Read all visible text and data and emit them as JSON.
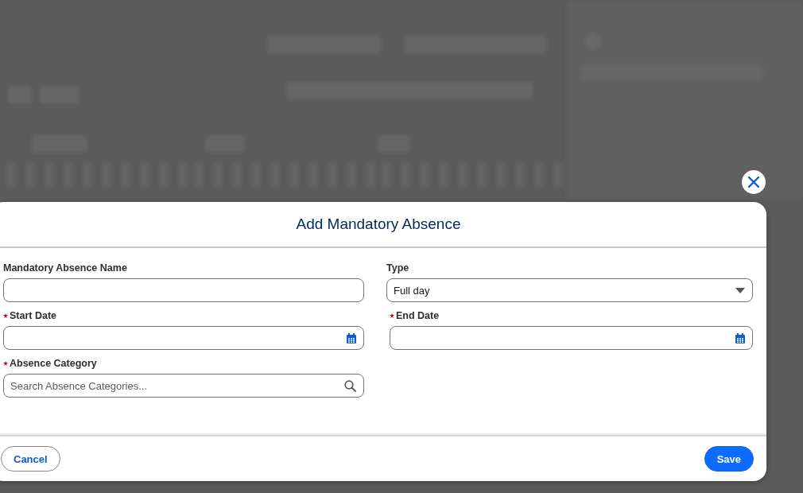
{
  "modal": {
    "title": "Add Mandatory Absence",
    "fields": [
      {
        "kind": "text",
        "label": "Mandatory Absence Name",
        "required": false
      },
      {
        "kind": "select",
        "label": "Type",
        "required": false,
        "value": "Full day"
      },
      {
        "kind": "date",
        "label": "Start Date",
        "required": true
      },
      {
        "kind": "date",
        "label": "End Date",
        "required": true
      },
      {
        "kind": "lookup",
        "label": "Absence Category",
        "required": true,
        "placeholder": "Search Absence Categories..."
      }
    ],
    "buttons": [
      {
        "kind": "neutral",
        "label": "Cancel"
      },
      {
        "kind": "brand",
        "label": "Save"
      }
    ]
  }
}
